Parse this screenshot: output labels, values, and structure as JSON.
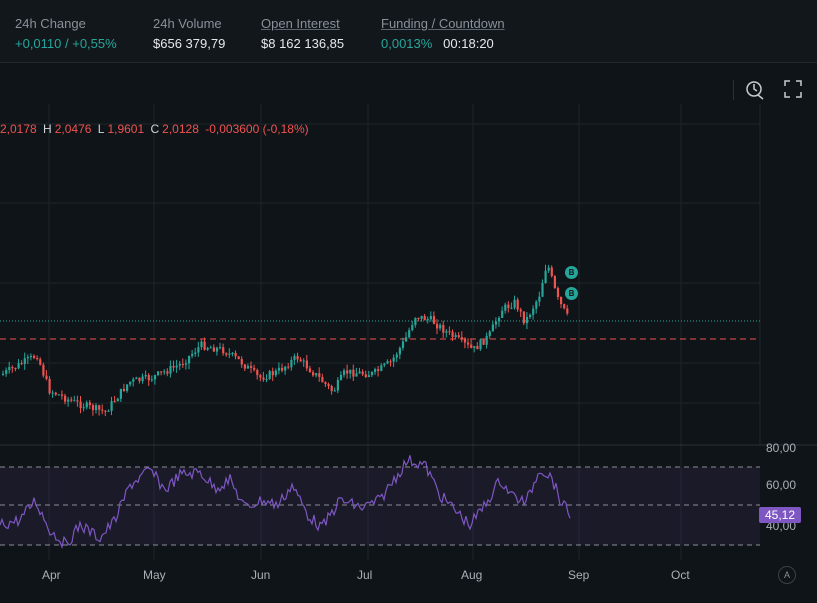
{
  "stats": {
    "change": {
      "label": "24h Change",
      "value": "+0,0110 / +0,55%"
    },
    "volume": {
      "label": "24h Volume",
      "value": "$656 379,79"
    },
    "open_interest": {
      "label": "Open Interest",
      "value": "$8 162 136,85"
    },
    "funding": {
      "label": "Funding / Countdown",
      "rate": "0,0013%",
      "countdown": "00:18:20"
    }
  },
  "toolbar": {
    "icons": [
      "replay-clock-icon",
      "fullscreen-icon"
    ]
  },
  "ohlc": {
    "o_label": "",
    "o": "2,0178",
    "h_label": "H",
    "h": "2,0476",
    "l_label": "L",
    "l": "1,9601",
    "c_label": "C",
    "c": "2,0128",
    "change": "-0,003600 (-0,18%)"
  },
  "markers": [
    "B",
    "B"
  ],
  "rsi": {
    "axis_labels": [
      "80,00",
      "60,00",
      "40,00"
    ],
    "current": "45,12"
  },
  "time_axis": [
    "Apr",
    "May",
    "Jun",
    "Jul",
    "Aug",
    "Sep",
    "Oct"
  ],
  "auto_label": "A",
  "colors": {
    "up": "#26a69a",
    "down": "#ef5350",
    "rsi": "#7e57c2",
    "background": "#0f1418"
  }
}
